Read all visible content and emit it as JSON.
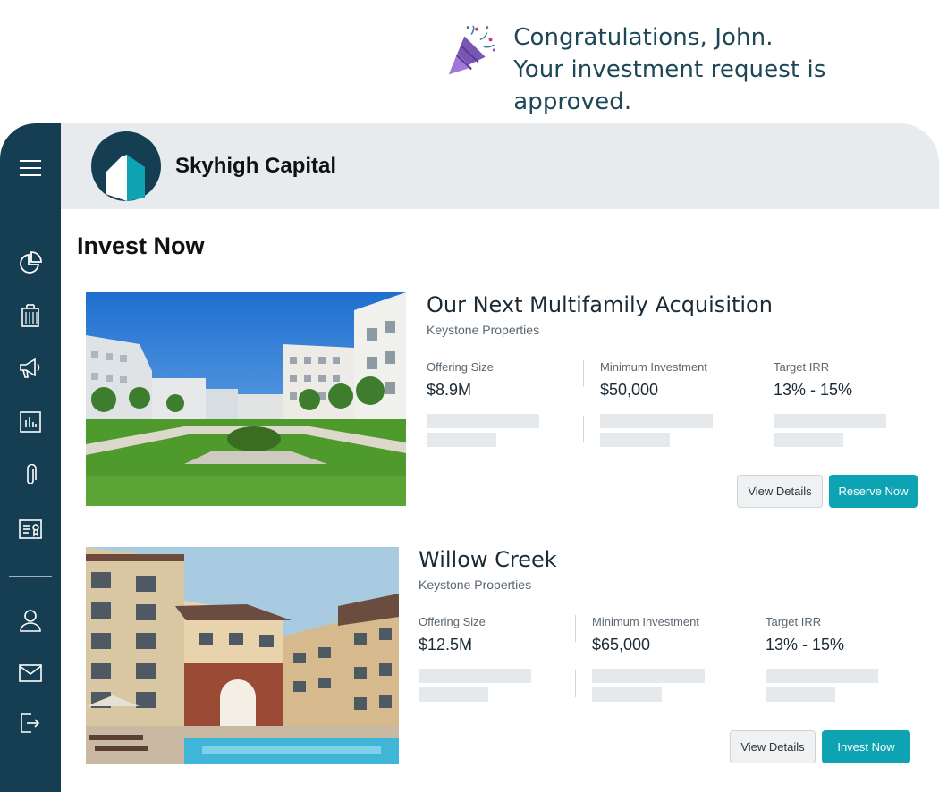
{
  "congrats": {
    "line1": "Congratulations, John.",
    "line2": "Your investment request is approved.",
    "icon": "party-popper-icon"
  },
  "brand": {
    "name": "Skyhigh Capital"
  },
  "page": {
    "title": "Invest Now"
  },
  "sidebar": {
    "items": [
      {
        "icon": "menu-icon"
      },
      {
        "icon": "pie-chart-icon"
      },
      {
        "icon": "building-icon"
      },
      {
        "icon": "megaphone-icon"
      },
      {
        "icon": "bar-chart-icon"
      },
      {
        "icon": "paperclip-icon"
      },
      {
        "icon": "certificate-icon"
      },
      {
        "icon": "user-icon"
      },
      {
        "icon": "mail-icon"
      },
      {
        "icon": "logout-icon"
      }
    ]
  },
  "listings": [
    {
      "title": "Our Next Multifamily Acquisition",
      "sponsor": "Keystone Properties",
      "metrics": [
        {
          "label": "Offering Size",
          "value": "$8.9M"
        },
        {
          "label": "Minimum Investment",
          "value": "$50,000"
        },
        {
          "label": "Target IRR",
          "value": "13% - 15%"
        }
      ],
      "secondary_button": "View Details",
      "primary_button": "Reserve Now"
    },
    {
      "title": "Willow Creek",
      "sponsor": "Keystone Properties",
      "metrics": [
        {
          "label": "Offering Size",
          "value": "$12.5M"
        },
        {
          "label": "Minimum Investment",
          "value": "$65,000"
        },
        {
          "label": "Target IRR",
          "value": "13% - 15%"
        }
      ],
      "secondary_button": "View Details",
      "primary_button": "Invest Now"
    }
  ],
  "colors": {
    "sidebar": "#163e52",
    "accent": "#0ea3b3",
    "topbar": "#e7ebee"
  }
}
